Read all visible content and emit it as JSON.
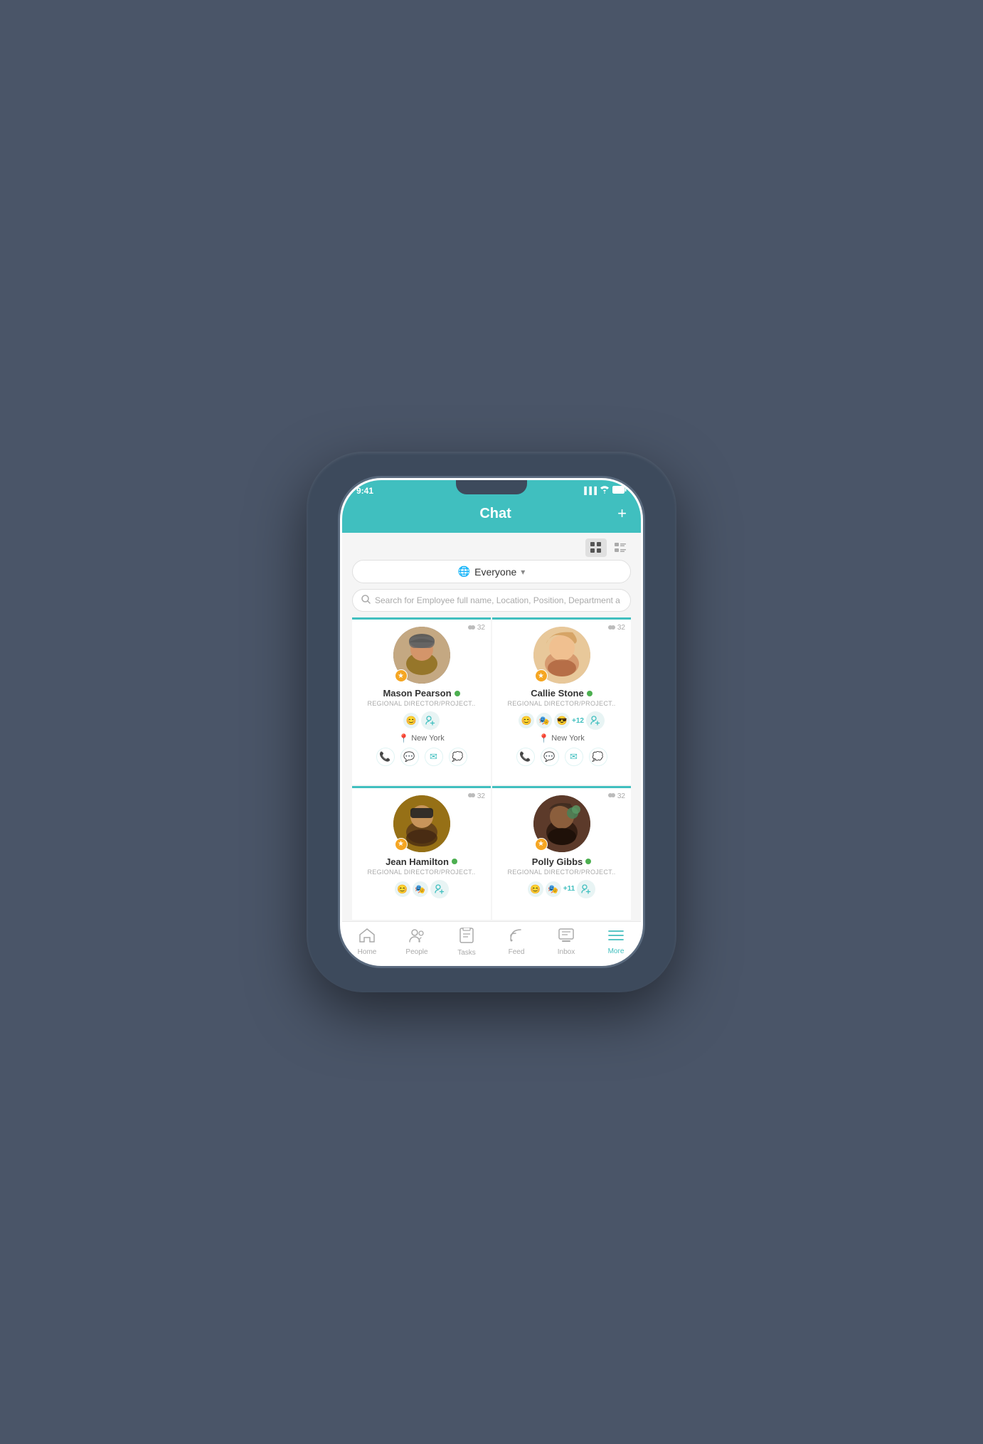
{
  "device": {
    "status_bar": {
      "time": "9:41",
      "signal": "▐▐▐",
      "wifi": "WiFi",
      "battery": "Battery"
    }
  },
  "header": {
    "title": "Chat",
    "plus_label": "+"
  },
  "view_toggle": {
    "grid_active": true
  },
  "filter": {
    "label": "Everyone",
    "chevron": "▾"
  },
  "search": {
    "placeholder": "Search for Employee full name, Location, Position, Department a"
  },
  "people": [
    {
      "name": "Mason Pearson",
      "role": "REGIONAL DIRECTOR/PROJECT..",
      "location": "New York",
      "count": "32",
      "emoji": [
        "😊",
        ""
      ],
      "online": true
    },
    {
      "name": "Callie Stone",
      "role": "REGIONAL DIRECTOR/PROJECT..",
      "location": "New York",
      "count": "32",
      "emoji": [
        "😊",
        "🎭",
        "😎"
      ],
      "extra_count": "+12",
      "online": true
    },
    {
      "name": "Jean Hamilton",
      "role": "REGIONAL DIRECTOR/PROJECT..",
      "location": "",
      "count": "32",
      "emoji": [
        "😊",
        "🎭"
      ],
      "online": true
    },
    {
      "name": "Polly Gibbs",
      "role": "REGIONAL DIRECTOR/PROJECT..",
      "location": "",
      "count": "32",
      "emoji": [
        "😊",
        "🎭"
      ],
      "extra_count": "+11",
      "online": true
    }
  ],
  "nav": {
    "items": [
      {
        "label": "Home",
        "icon": "🏠",
        "active": false
      },
      {
        "label": "People",
        "icon": "👤",
        "active": false
      },
      {
        "label": "Tasks",
        "icon": "📋",
        "active": false
      },
      {
        "label": "Feed",
        "icon": "📡",
        "active": false
      },
      {
        "label": "Inbox",
        "icon": "💬",
        "active": false
      },
      {
        "label": "More",
        "icon": "≡",
        "active": true
      }
    ]
  }
}
